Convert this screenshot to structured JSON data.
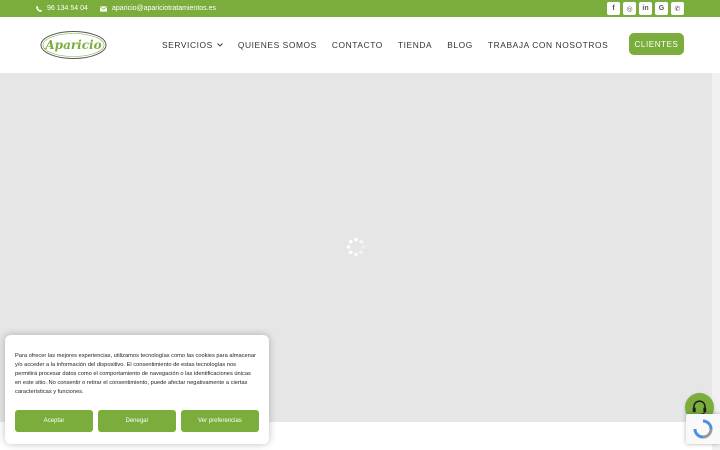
{
  "topbar": {
    "phone": "96 134 54 04",
    "email": "aparicio@apariciotratamientos.es",
    "social": [
      {
        "icon": "facebook-icon",
        "glyph": "f"
      },
      {
        "icon": "instagram-icon",
        "glyph": "◎"
      },
      {
        "icon": "linkedin-icon",
        "glyph": "in"
      },
      {
        "icon": "google-icon",
        "glyph": "G"
      },
      {
        "icon": "phone-icon",
        "glyph": "✆"
      }
    ]
  },
  "header": {
    "logo_text": "Aparicio",
    "nav": {
      "servicios": "SERVICIOS",
      "quienes": "QUIENES SOMOS",
      "contacto": "CONTACTO",
      "tienda": "TIENDA",
      "blog": "BLOG",
      "trabaja": "TRABAJA CON NOSOTROS"
    },
    "clients_button": "CLIENTES"
  },
  "cookie": {
    "message": "Para ofrecer las mejores experiencias, utilizamos tecnologías como las cookies para almacenar y/o acceder a la información del dispositivo. El consentimiento de estas tecnologías nos permitirá procesar datos como el comportamiento de navegación o las identificaciones únicas en este sitio. No consentir o retirar el consentimiento, puede afectar negativamente a ciertas características y funciones.",
    "accept": "Aceptar",
    "deny": "Denegar",
    "preferences": "Ver preferencias"
  },
  "colors": {
    "brand_green": "#7aad3c",
    "hero_bg": "#e6e6e6"
  }
}
